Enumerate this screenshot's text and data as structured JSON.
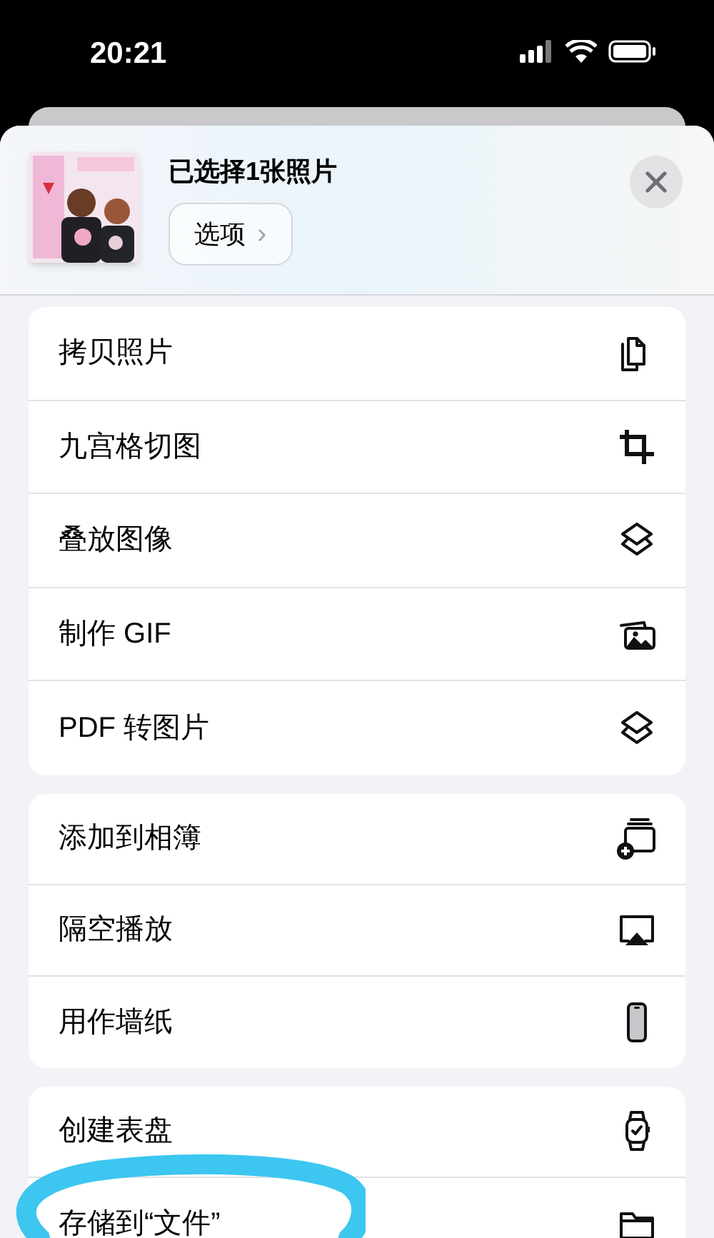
{
  "status_bar": {
    "time": "20:21"
  },
  "header": {
    "title": "已选择1张照片",
    "options_button": "选项",
    "options_chevron": "›"
  },
  "action_groups": [
    [
      {
        "label": "拷贝照片"
      },
      {
        "label": "九宫格切图"
      },
      {
        "label": "叠放图像"
      },
      {
        "label": "制作 GIF"
      },
      {
        "label": "PDF 转图片"
      }
    ],
    [
      {
        "label": "添加到相簿"
      },
      {
        "label": "隔空播放"
      },
      {
        "label": "用作墙纸"
      }
    ],
    [
      {
        "label": "创建表盘"
      },
      {
        "label": "存储到“文件”"
      }
    ]
  ]
}
